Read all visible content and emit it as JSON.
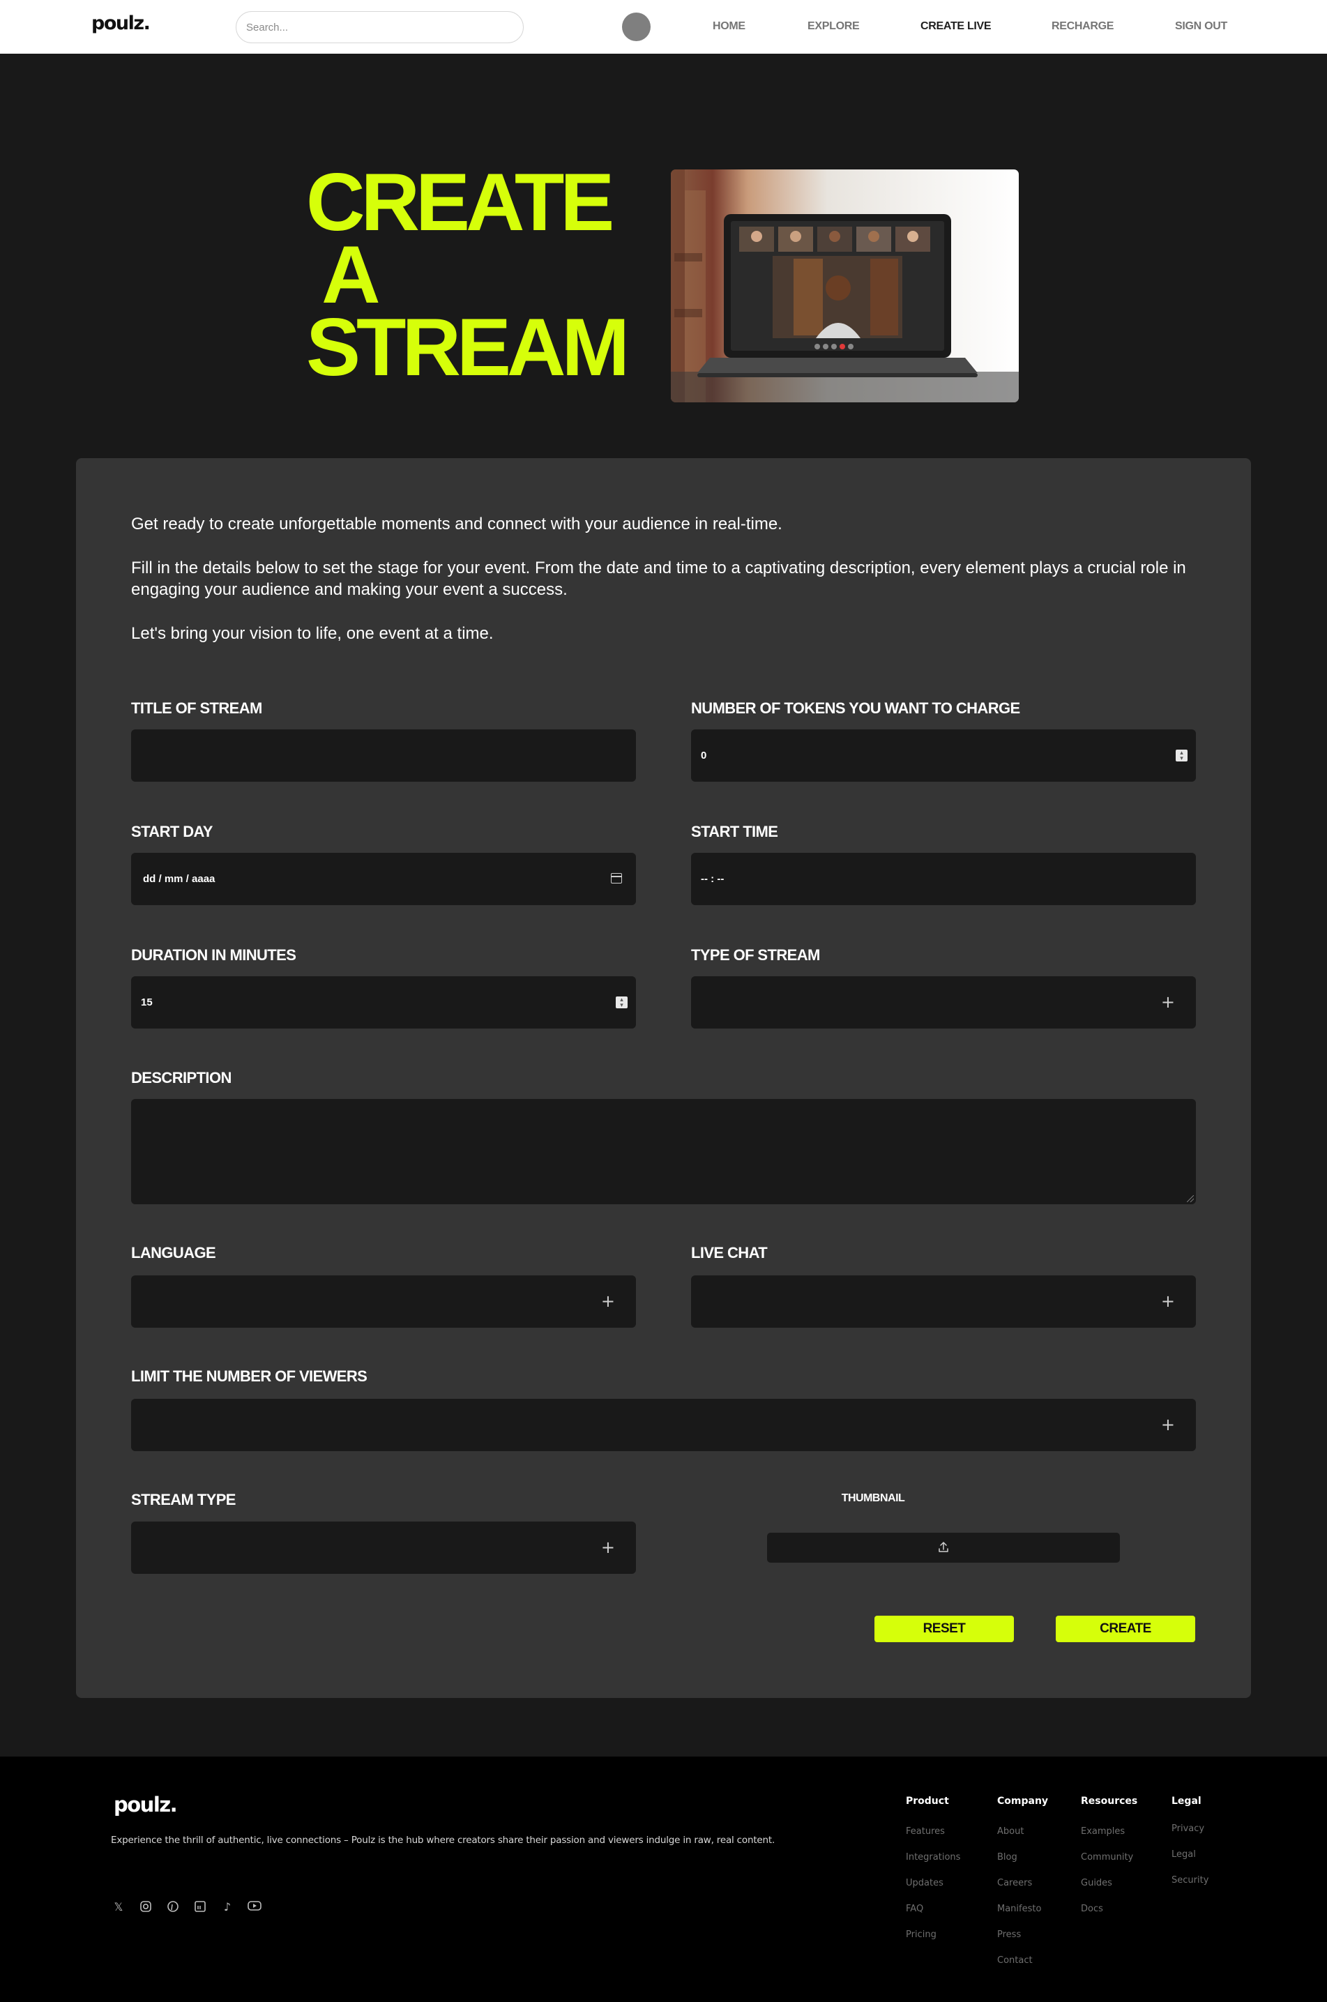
{
  "header": {
    "logo": "poulz.",
    "search_placeholder": "Search...",
    "nav": [
      "HOME",
      "EXPLORE",
      "CREATE LIVE",
      "RECHARGE",
      "SIGN OUT"
    ]
  },
  "hero": {
    "title": "CREATE\n A\nSTREAM"
  },
  "intro": {
    "p1": "Get ready to create unforgettable moments and connect with your audience in real-time.",
    "p2": "Fill in the details below to set the stage for your event. From the date and time to a captivating description, every element plays a crucial role in engaging your audience and making your event a success.",
    "p3": "Let's bring your vision to life, one event at a time."
  },
  "form": {
    "title_label": "TITLE OF STREAM",
    "tokens_label": "NUMBER OF TOKENS YOU WANT TO CHARGE",
    "tokens_value": "0",
    "start_day_label": "START DAY",
    "start_day_placeholder": "dd / mm / aaaa",
    "start_time_label": "START TIME",
    "start_time_placeholder": "-- : --",
    "duration_label": "DURATION IN MINUTES",
    "duration_value": "15",
    "type_label": "TYPE OF STREAM",
    "description_label": "DESCRIPTION",
    "language_label": "LANGUAGE",
    "live_chat_label": "LIVE CHAT",
    "limit_label": "LIMIT THE NUMBER OF VIEWERS",
    "stream_type_label": "STREAM TYPE",
    "thumbnail_label": "THUMBNAIL",
    "reset_label": "RESET",
    "create_label": "CREATE"
  },
  "footer": {
    "logo": "poulz.",
    "tagline": "Experience the thrill of authentic, live connections – Poulz is the hub where creators share their passion and viewers indulge in raw, real content.",
    "social_icons": [
      "x-icon",
      "instagram-icon",
      "pinterest-icon",
      "linkedin-icon",
      "tiktok-icon",
      "youtube-icon"
    ],
    "columns": [
      {
        "title": "Product",
        "links": [
          "Features",
          "Integrations",
          "Updates",
          "FAQ",
          "Pricing"
        ]
      },
      {
        "title": "Company",
        "links": [
          "About",
          "Blog",
          "Careers",
          "Manifesto",
          "Press",
          "Contact"
        ]
      },
      {
        "title": "Resources",
        "links": [
          "Examples",
          "Community",
          "Guides",
          "Docs"
        ]
      },
      {
        "title": "Legal",
        "links": [
          "Privacy",
          "Legal",
          "Security"
        ]
      }
    ]
  },
  "colors": {
    "accent": "#d6ff0a",
    "background": "#191919",
    "card": "#353535",
    "input": "#191919"
  }
}
